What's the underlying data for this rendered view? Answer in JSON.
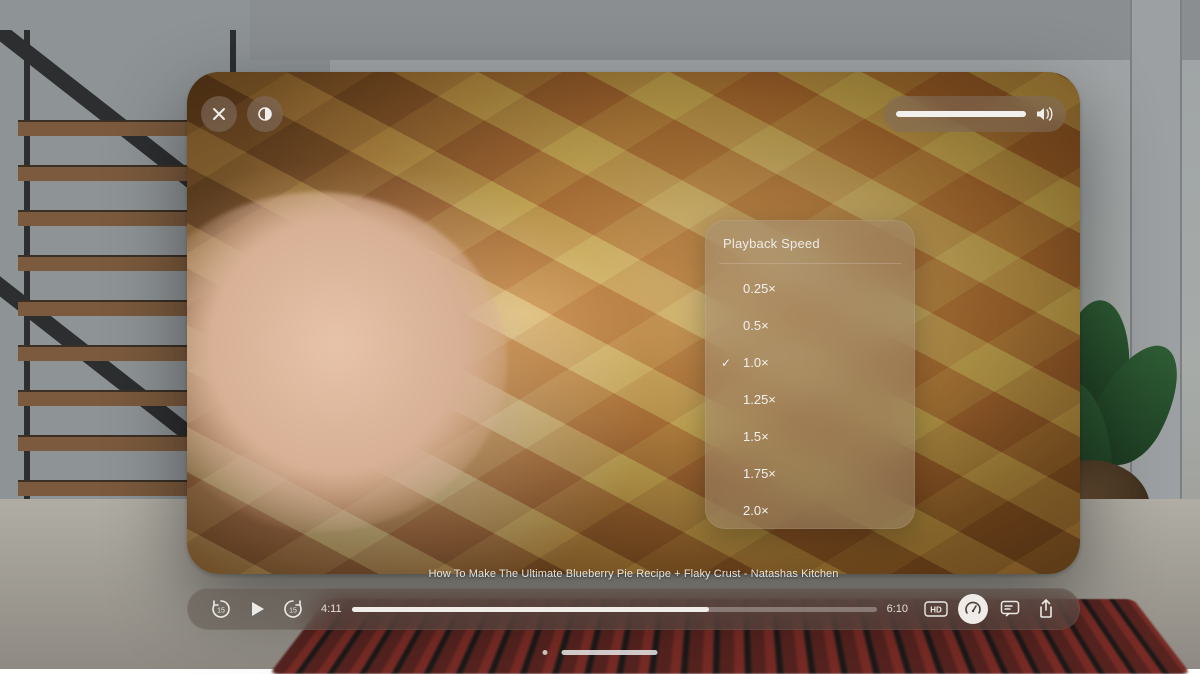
{
  "video": {
    "title": "How To Make The Ultimate Blueberry Pie Recipe + Flaky Crust - Natashas Kitchen"
  },
  "playback": {
    "current_time": "4:11",
    "duration": "6:10",
    "progress_pct": 68,
    "skip_back_seconds": "15",
    "skip_fwd_seconds": "15",
    "hd_label": "HD"
  },
  "speed_menu": {
    "title": "Playback Speed",
    "selected": "1.0×",
    "options": [
      "0.25×",
      "0.5×",
      "1.0×",
      "1.25×",
      "1.5×",
      "1.75×",
      "2.0×"
    ]
  },
  "volume": {
    "level_pct": 100
  }
}
